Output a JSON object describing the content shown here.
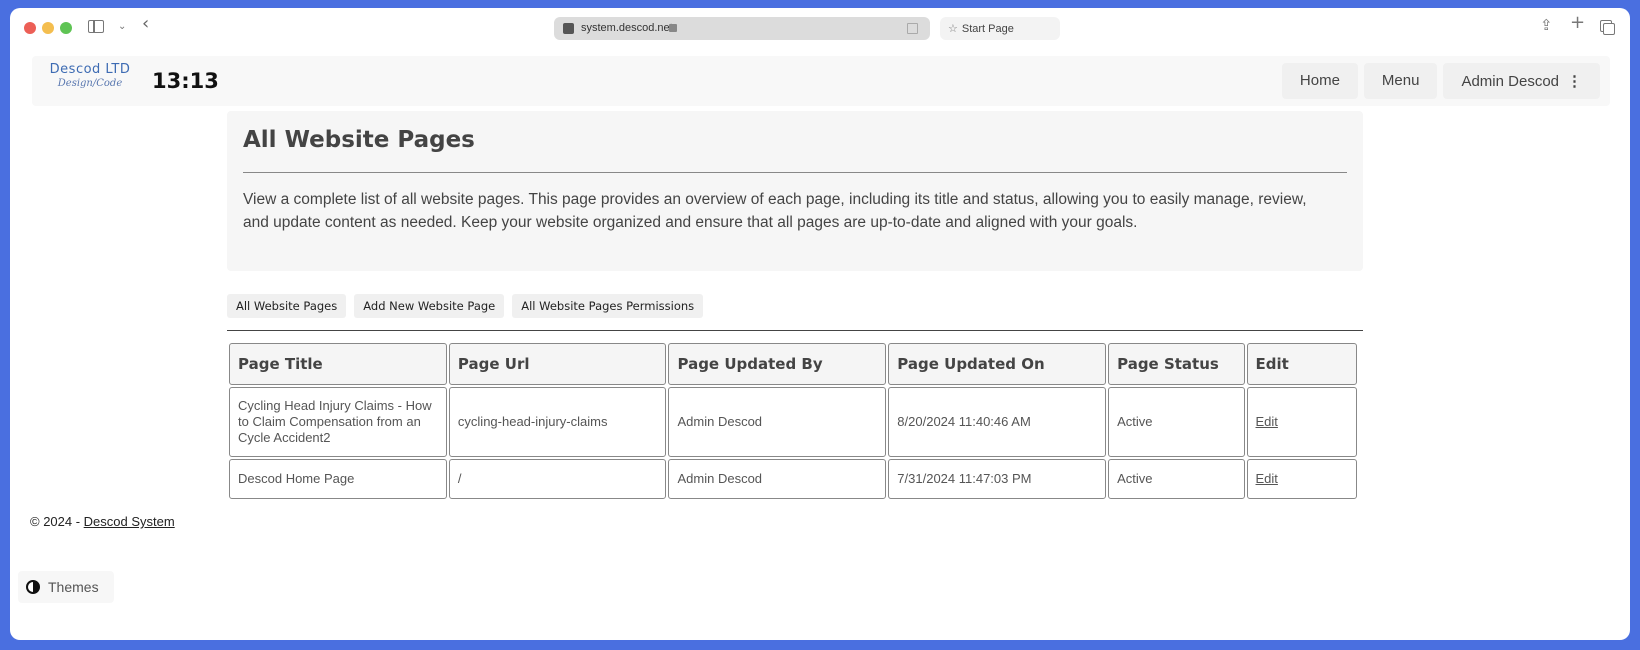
{
  "browser": {
    "url": "system.descod.net",
    "start_page_label": "Start Page"
  },
  "header": {
    "logo_main": "Descod LTD",
    "logo_sub": "Design/Code",
    "clock": "13:13",
    "nav": [
      {
        "label": "Home"
      },
      {
        "label": "Menu"
      },
      {
        "label": "Admin Descod"
      }
    ]
  },
  "panel": {
    "title": "All Website Pages",
    "description": "View a complete list of all website pages. This page provides an overview of each page, including its title and status, allowing you to easily manage, review, and update content as needed. Keep your website organized and ensure that all pages are up-to-date and aligned with your goals."
  },
  "subnav": [
    {
      "label": "All Website Pages"
    },
    {
      "label": "Add New Website Page"
    },
    {
      "label": "All Website Pages Permissions"
    }
  ],
  "table": {
    "columns": [
      "Page Title",
      "Page Url",
      "Page Updated By",
      "Page Updated On",
      "Page Status",
      "Edit"
    ],
    "rows": [
      {
        "title": "Cycling Head Injury Claims - How to Claim Compensation from an Cycle Accident2",
        "url": "cycling-head-injury-claims",
        "updated_by": "Admin Descod",
        "updated_on": "8/20/2024 11:40:46 AM",
        "status": "Active",
        "edit": "Edit"
      },
      {
        "title": "Descod Home Page",
        "url": "/",
        "updated_by": "Admin Descod",
        "updated_on": "7/31/2024 11:47:03 PM",
        "status": "Active",
        "edit": "Edit"
      }
    ]
  },
  "footer": {
    "copyright": "© 2024 - ",
    "link": "Descod System"
  },
  "themes_label": "Themes",
  "colors": {
    "background": "#4a6fe0",
    "logo_blue": "#3d6bb3"
  }
}
